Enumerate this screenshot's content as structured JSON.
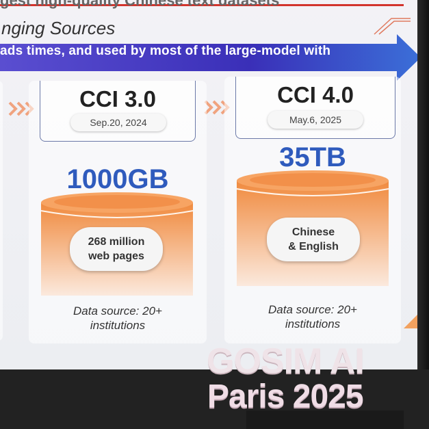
{
  "slide": {
    "top_partial_text": "gest high-quality Chinese text datasets",
    "subtitle": "nging Sources",
    "arrow_text": "ads times, and used by most of the large-model with",
    "colors": {
      "arrow": "#3a2fb8",
      "size_text": "#2f5bbd",
      "cylinder": "#f29e55"
    }
  },
  "cards": [
    {
      "version": "CCI 3.0",
      "date": "Sep.20, 2024",
      "size": "1000GB",
      "content": "268 million\nweb pages",
      "source": "Data source: 20+\ninstitutions"
    },
    {
      "version": "CCI 4.0",
      "date": "May.6, 2025",
      "size": "35TB",
      "content": "Chinese\n& English",
      "source": "Data source: 20+\ninstitutions"
    }
  ],
  "signage": {
    "line1": "GOSIM AI",
    "line2": "Paris 2025"
  }
}
